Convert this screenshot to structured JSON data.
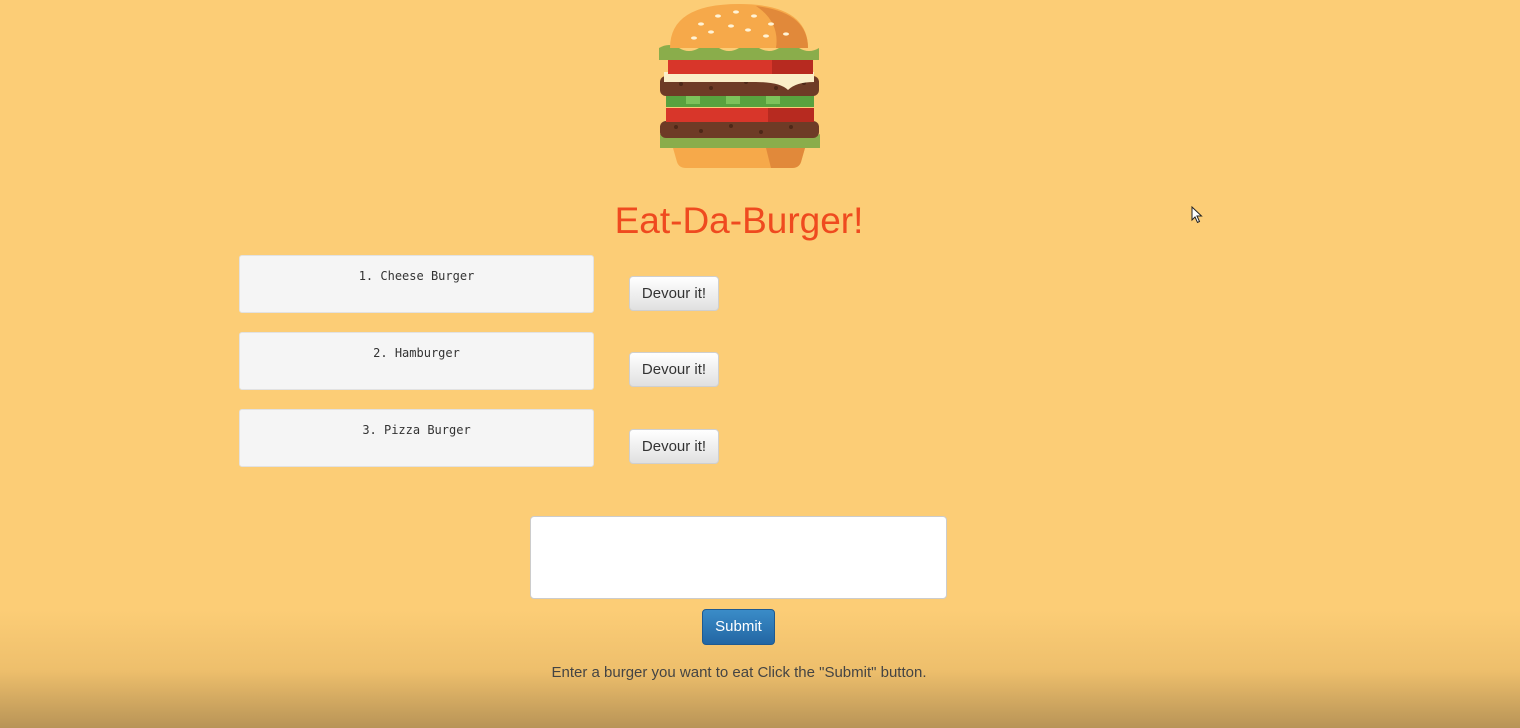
{
  "page": {
    "title": "Eat-Da-Burger!",
    "instructions": "Enter a burger you want to eat Click the \"Submit\" button."
  },
  "logo": {
    "icon": "hamburger-icon"
  },
  "burgers": [
    {
      "label": "1. Cheese Burger",
      "action_label": "Devour it!"
    },
    {
      "label": "2. Hamburger",
      "action_label": "Devour it!"
    },
    {
      "label": "3. Pizza Burger",
      "action_label": "Devour it!"
    }
  ],
  "form": {
    "input_value": "",
    "submit_label": "Submit"
  },
  "colors": {
    "background": "#fccd76",
    "title": "#ef4a1f",
    "submit": "#2e7bbf"
  }
}
